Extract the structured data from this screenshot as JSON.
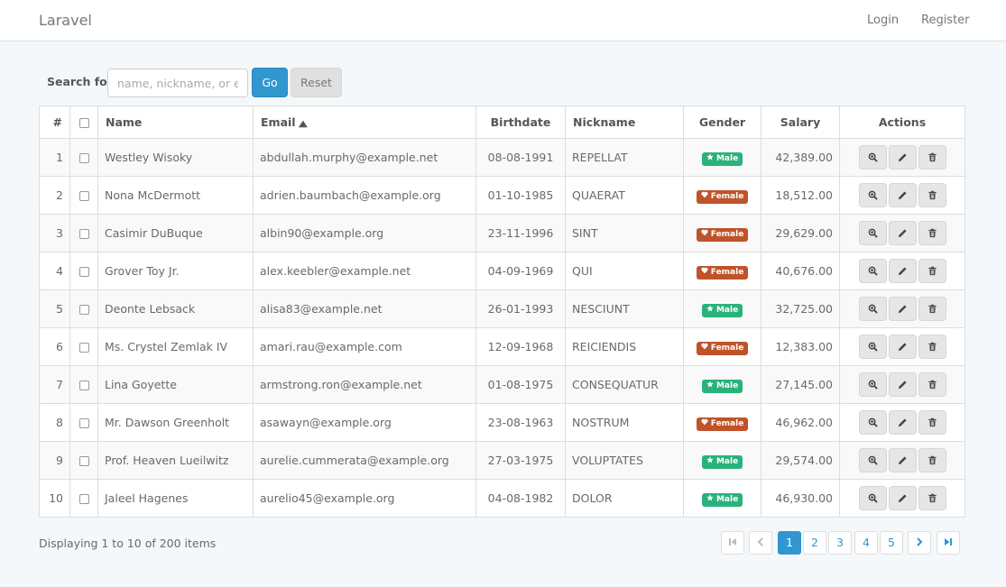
{
  "navbar": {
    "brand": "Laravel",
    "login": "Login",
    "register": "Register"
  },
  "search": {
    "label": "Search for:",
    "placeholder": "name, nickname, or email",
    "go": "Go",
    "reset": "Reset"
  },
  "table": {
    "headers": [
      "#",
      "",
      "Name",
      "Email",
      "Birthdate",
      "Nickname",
      "Gender",
      "Salary",
      "Actions"
    ],
    "sorted_column": "Email",
    "rows": [
      {
        "num": "1",
        "name": "Westley Wisoky",
        "email": "abdullah.murphy@example.net",
        "birthdate": "08-08-1991",
        "nickname": "REPELLAT",
        "gender": "Male",
        "salary": "42,389.00"
      },
      {
        "num": "2",
        "name": "Nona McDermott",
        "email": "adrien.baumbach@example.org",
        "birthdate": "01-10-1985",
        "nickname": "QUAERAT",
        "gender": "Female",
        "salary": "18,512.00"
      },
      {
        "num": "3",
        "name": "Casimir DuBuque",
        "email": "albin90@example.org",
        "birthdate": "23-11-1996",
        "nickname": "SINT",
        "gender": "Female",
        "salary": "29,629.00"
      },
      {
        "num": "4",
        "name": "Grover Toy Jr.",
        "email": "alex.keebler@example.net",
        "birthdate": "04-09-1969",
        "nickname": "QUI",
        "gender": "Female",
        "salary": "40,676.00"
      },
      {
        "num": "5",
        "name": "Deonte Lebsack",
        "email": "alisa83@example.net",
        "birthdate": "26-01-1993",
        "nickname": "NESCIUNT",
        "gender": "Male",
        "salary": "32,725.00"
      },
      {
        "num": "6",
        "name": "Ms. Crystel Zemlak IV",
        "email": "amari.rau@example.com",
        "birthdate": "12-09-1968",
        "nickname": "REICIENDIS",
        "gender": "Female",
        "salary": "12,383.00"
      },
      {
        "num": "7",
        "name": "Lina Goyette",
        "email": "armstrong.ron@example.net",
        "birthdate": "01-08-1975",
        "nickname": "CONSEQUATUR",
        "gender": "Male",
        "salary": "27,145.00"
      },
      {
        "num": "8",
        "name": "Mr. Dawson Greenholt",
        "email": "asawayn@example.org",
        "birthdate": "23-08-1963",
        "nickname": "NOSTRUM",
        "gender": "Female",
        "salary": "46,962.00"
      },
      {
        "num": "9",
        "name": "Prof. Heaven Lueilwitz",
        "email": "aurelie.cummerata@example.org",
        "birthdate": "27-03-1975",
        "nickname": "VOLUPTATES",
        "gender": "Male",
        "salary": "29,574.00"
      },
      {
        "num": "10",
        "name": "Jaleel Hagenes",
        "email": "aurelio45@example.org",
        "birthdate": "04-08-1982",
        "nickname": "DOLOR",
        "gender": "Male",
        "salary": "46,930.00"
      }
    ],
    "row_actions": [
      "view",
      "edit",
      "delete"
    ]
  },
  "footer": {
    "summary": "Displaying 1 to 10 of 200 items"
  },
  "pagination": {
    "pages": [
      "1",
      "2",
      "3",
      "4",
      "5"
    ],
    "current": "1"
  },
  "colors": {
    "primary": "#3097d1",
    "male": "#2ab27b",
    "female": "#bf5329"
  },
  "icons": {
    "male": "star-icon",
    "female": "heart-icon",
    "view": "zoom-in-icon",
    "edit": "pencil-icon",
    "delete": "trash-icon",
    "first": "step-backward-icon",
    "prev": "chevron-left-icon",
    "next": "chevron-right-icon",
    "last": "step-forward-icon"
  }
}
